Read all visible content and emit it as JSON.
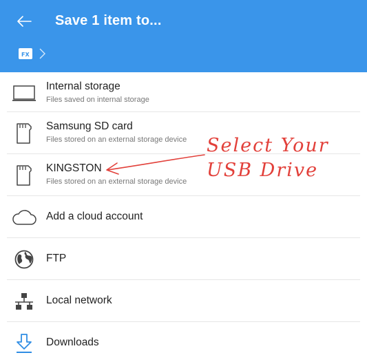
{
  "header": {
    "title": "Save 1 item to...",
    "back_icon": "arrow-left-icon"
  },
  "breadcrumb": {
    "root_icon": "fx-app-icon",
    "separator_icon": "chevron-right-icon"
  },
  "locations": [
    {
      "name": "Internal storage",
      "subtitle": "Files saved on internal storage",
      "icon": "monitor-icon"
    },
    {
      "name": "Samsung SD card",
      "subtitle": "Files stored on an external storage device",
      "icon": "sd-card-icon"
    },
    {
      "name": "KINGSTON",
      "subtitle": "Files stored on an external storage device",
      "icon": "sd-card-icon"
    },
    {
      "name": "Add a cloud account",
      "icon": "cloud-icon"
    },
    {
      "name": "FTP",
      "icon": "globe-icon"
    },
    {
      "name": "Local network",
      "icon": "network-icon"
    },
    {
      "name": "Downloads",
      "icon": "download-icon"
    }
  ],
  "annotation": {
    "line1": "Select Your",
    "line2": "USB Drive",
    "color": "#e2403a"
  },
  "colors": {
    "appbar": "#3a95ea",
    "accent": "#2f8de4"
  }
}
